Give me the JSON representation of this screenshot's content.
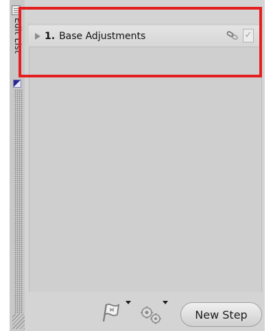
{
  "side_panel": {
    "tab_label": "Edit List",
    "icons": [
      "list-icon",
      "diagonal-marker-icon",
      "dotted-grip-icon",
      "resize-grip-icon"
    ]
  },
  "steps": [
    {
      "number": "1.",
      "name": "Base Adjustments",
      "icons": [
        "expand-arrow-icon",
        "link-icon",
        "check-icon"
      ],
      "checked": true
    }
  ],
  "check_glyph": "✓",
  "toolbar": {
    "new_step_label": "New Step",
    "icons": [
      "flag-icon",
      "gears-icon"
    ]
  },
  "colors": {
    "highlight": "#e41e1e",
    "panel_bg": "#d4d4d4"
  }
}
